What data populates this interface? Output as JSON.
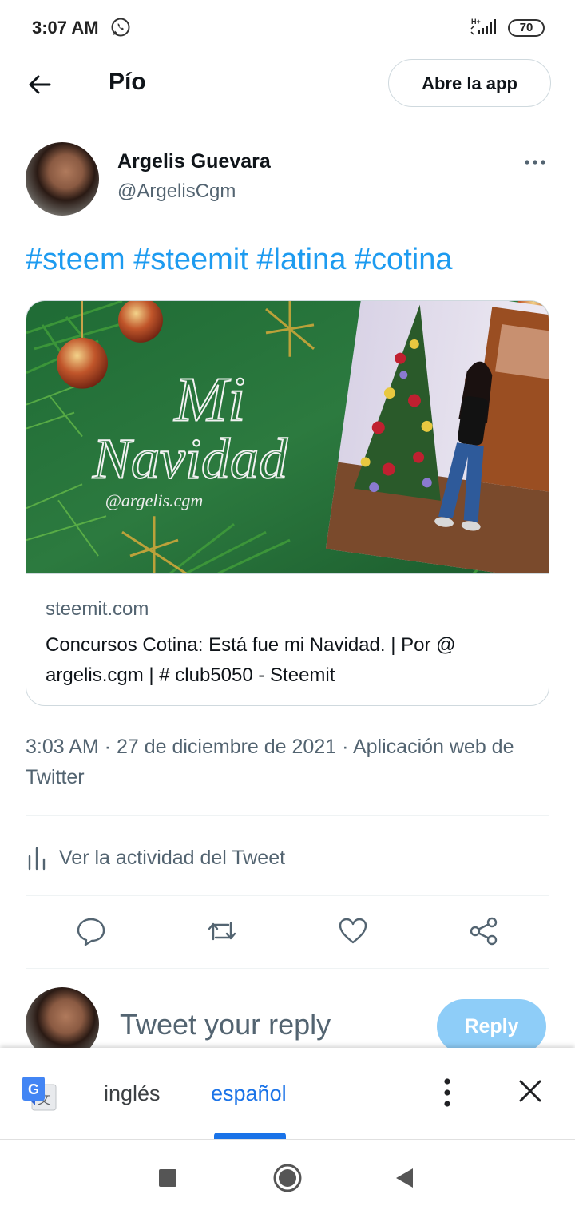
{
  "status_bar": {
    "time": "3:07 AM",
    "network": "H+",
    "battery": "70"
  },
  "header": {
    "title": "Pío",
    "open_app": "Abre la app"
  },
  "tweet": {
    "author_name": "Argelis Guevara",
    "author_handle": "@ArgelisCgm",
    "hashtags": [
      "#steem",
      "#steemit",
      "#latina",
      "#cotina"
    ],
    "card": {
      "image_text_line1": "Mi",
      "image_text_line2": "Navidad",
      "image_text_credit": "@argelis.cgm",
      "domain": "steemit.com",
      "title": "Concursos Cotina: Está fue mi Navidad. | Por @ argelis.cgm | # club5050 - Steemit"
    },
    "timestamp": "3:03 AM · 27 de diciembre de 2021  ·  Aplicación web de Twitter",
    "activity_label": "Ver la actividad del Tweet"
  },
  "reply": {
    "placeholder": "Tweet your reply",
    "button": "Reply"
  },
  "translate_bar": {
    "source_lang": "inglés",
    "target_lang": "español",
    "selected": "español"
  },
  "colors": {
    "accent": "#1d9bf0",
    "text_primary": "#0f1419",
    "text_secondary": "#536471",
    "reply_button_disabled": "#8ecdf8",
    "translate_blue": "#1a73e8"
  }
}
